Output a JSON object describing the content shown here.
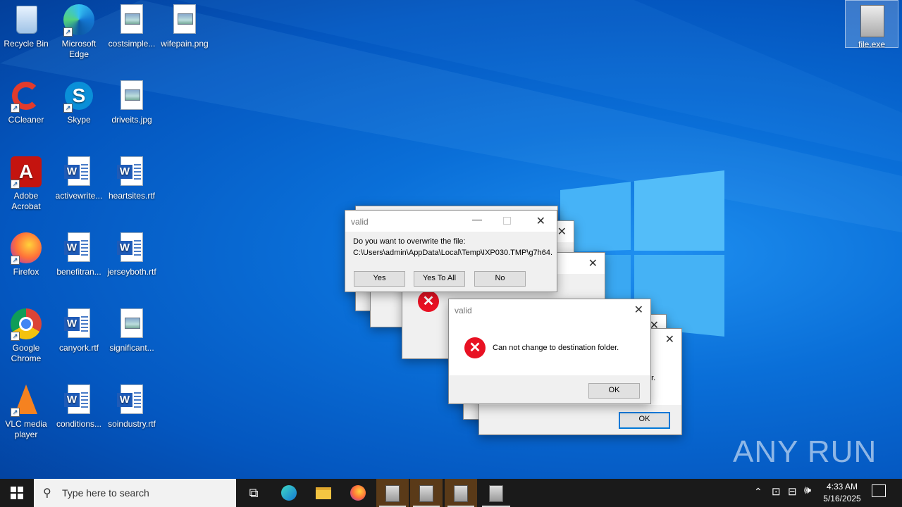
{
  "desktop_icons": [
    {
      "label": "Recycle Bin",
      "type": "recycle"
    },
    {
      "label": "Microsoft Edge",
      "type": "edge"
    },
    {
      "label": "costsimple...",
      "type": "image"
    },
    {
      "label": "wifepain.png",
      "type": "image"
    },
    {
      "label": "CCleaner",
      "type": "ccleaner"
    },
    {
      "label": "Skype",
      "type": "skype"
    },
    {
      "label": "driveits.jpg",
      "type": "image"
    },
    {
      "label": "Adobe Acrobat",
      "type": "acrobat"
    },
    {
      "label": "activewrite...",
      "type": "word"
    },
    {
      "label": "heartsites.rtf",
      "type": "word"
    },
    {
      "label": "Firefox",
      "type": "firefox"
    },
    {
      "label": "benefitran...",
      "type": "word"
    },
    {
      "label": "jerseyboth.rtf",
      "type": "word"
    },
    {
      "label": "Google Chrome",
      "type": "chrome"
    },
    {
      "label": "canyork.rtf",
      "type": "word"
    },
    {
      "label": "significant...",
      "type": "image"
    },
    {
      "label": "VLC media player",
      "type": "vlc"
    },
    {
      "label": "conditions...",
      "type": "word"
    },
    {
      "label": "soindustry.rtf",
      "type": "word"
    },
    {
      "label": "file.exe",
      "type": "exe"
    }
  ],
  "overwrite_dialog": {
    "title": "valid",
    "message_line1": "Do you want to overwrite the file:",
    "message_line2": "C:\\Users\\admin\\AppData\\Local\\Temp\\IXP030.TMP\\g7h64.",
    "yes_label": "Yes",
    "yes_all_label": "Yes To All",
    "no_label": "No"
  },
  "error_dialog": {
    "title": "valid",
    "message": "Can not change to destination folder.",
    "ok_label": "OK"
  },
  "back_dialog": {
    "partial_text": "er.",
    "ok_label": "OK"
  },
  "taskbar": {
    "search_placeholder": "Type here to search",
    "time": "4:33 AM",
    "date": "5/16/2025"
  },
  "watermark": "ANY RUN"
}
